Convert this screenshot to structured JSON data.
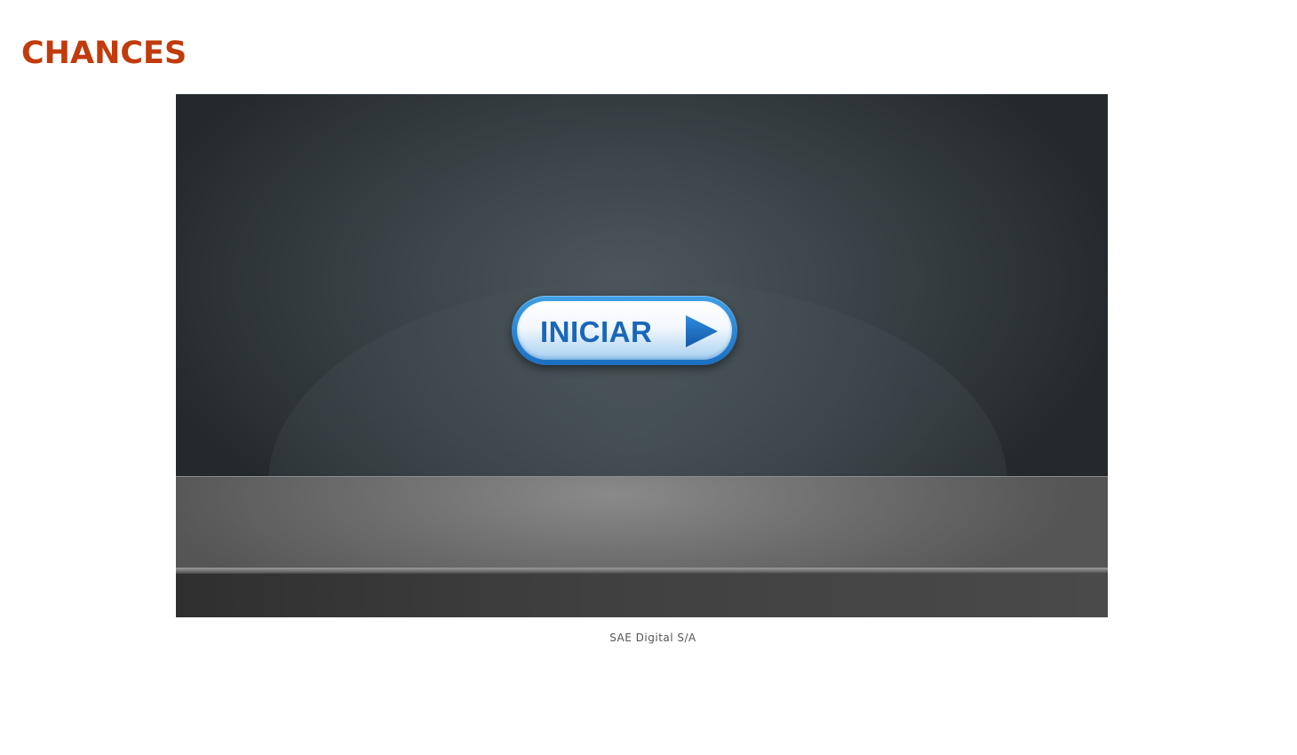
{
  "header": {
    "title": "CHANCES",
    "title_color": "#c23b0c"
  },
  "stage": {
    "start_button": {
      "label": "INICIAR",
      "icon": "play-icon",
      "accent_color": "#1a66b8"
    }
  },
  "footer": {
    "text": "SAE Digital S/A"
  }
}
